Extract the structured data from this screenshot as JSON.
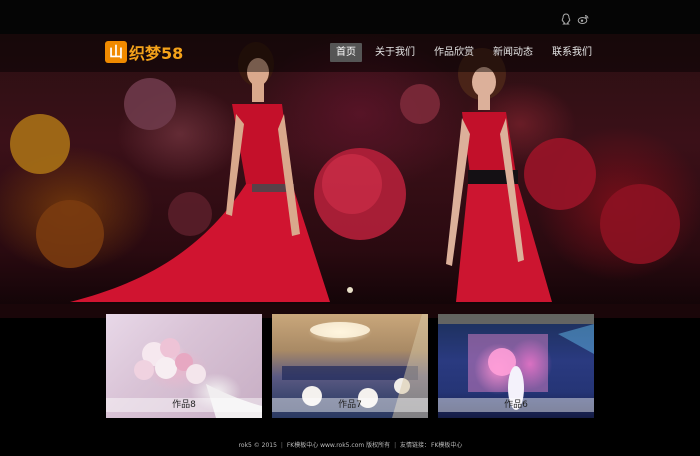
{
  "header": {
    "logo_badge": "山",
    "logo_text": "织梦58",
    "social": [
      "qq-icon",
      "weibo-icon"
    ]
  },
  "nav": {
    "items": [
      "首页",
      "关于我们",
      "作品欣赏",
      "新闻动态",
      "联系我们"
    ],
    "active_index": 0
  },
  "banner": {
    "slides_visible": 1
  },
  "gallery": {
    "items": [
      {
        "label": "作品8"
      },
      {
        "label": "作品7"
      },
      {
        "label": "作品6"
      }
    ]
  },
  "footer": {
    "copyright": "rok5 © 2015",
    "site": "FK模板中心 www.rok5.com 版权所有",
    "links_label": "友情链接：",
    "links": [
      "FK模板中心"
    ]
  },
  "colors": {
    "background": "#000000",
    "logo_orange": "#f08a00",
    "nav_active": "#555555"
  }
}
